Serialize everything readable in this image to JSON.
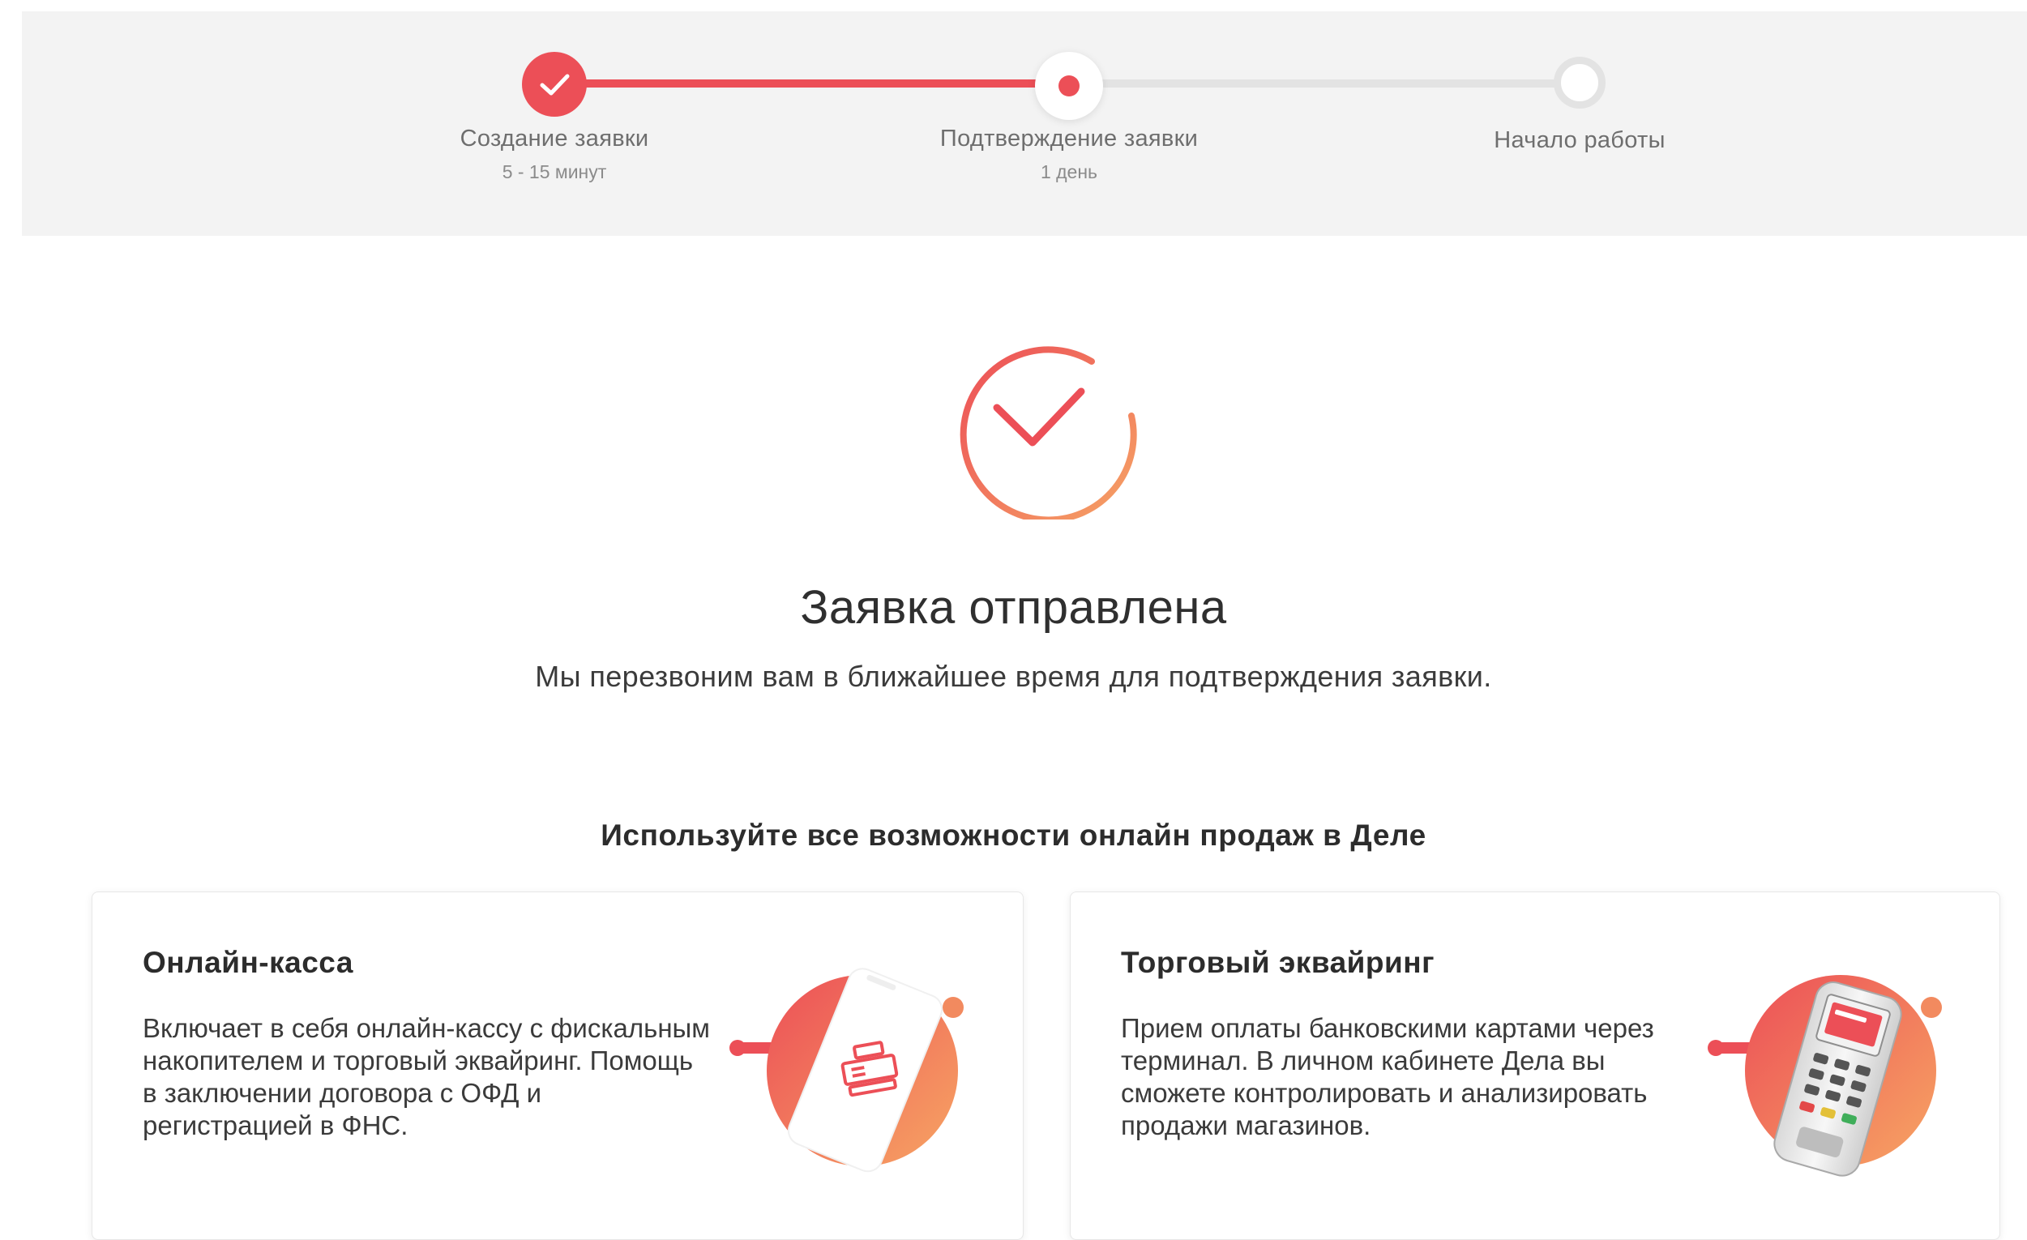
{
  "stepper": {
    "steps": [
      {
        "title": "Создание заявки",
        "subtitle": "5 - 15 минут",
        "state": "completed"
      },
      {
        "title": "Подтверждение заявки",
        "subtitle": "1 день",
        "state": "active"
      },
      {
        "title": "Начало работы",
        "subtitle": "",
        "state": "pending"
      }
    ]
  },
  "success": {
    "title": "Заявка отправлена",
    "text": "Мы перезвоним вам в ближайшее время для подтверждения заявки.",
    "icon": "checkmark-circle-icon"
  },
  "features": {
    "heading": "Используйте все возможности онлайн продаж в Деле",
    "cards": [
      {
        "title": "Онлайн-касса",
        "text": "Включает в себя онлайн-кассу с фискальным накопителем и торговый эквайринг. Помощь в заключении договора с ОФД и регистрацией в ФНС.",
        "icon": "smartphone-cash-register-illustration"
      },
      {
        "title": "Торговый эквайринг",
        "text": "Прием оплаты банковскими картами через терминал. В личном кабинете Дела вы сможете контролировать и анализировать продажи магазинов.",
        "icon": "payment-terminal-illustration"
      }
    ]
  },
  "colors": {
    "accent": "#ec4f57",
    "accent_gradient_end": "#f6a365",
    "band_background": "#f3f3f3",
    "track_inactive": "#e3e3e3"
  }
}
